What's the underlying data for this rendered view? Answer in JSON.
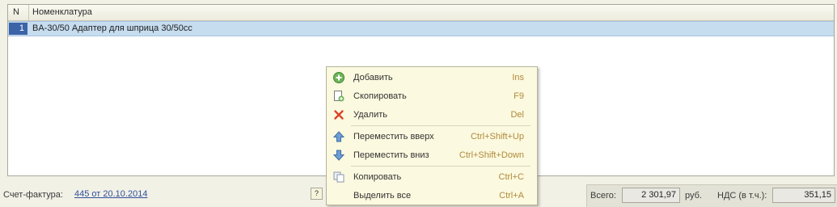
{
  "grid": {
    "headers": {
      "n": "N",
      "name": "Номенклатура"
    },
    "rows": [
      {
        "n": "1",
        "name": "BA-30/50 Адаптер для шприца 30/50cc"
      }
    ]
  },
  "context_menu": {
    "items": [
      {
        "label": "Добавить",
        "shortcut": "Ins",
        "icon": "add-icon"
      },
      {
        "label": "Скопировать",
        "shortcut": "F9",
        "icon": "copy-document-icon"
      },
      {
        "label": "Удалить",
        "shortcut": "Del",
        "icon": "delete-icon"
      },
      {
        "label": "Переместить вверх",
        "shortcut": "Ctrl+Shift+Up",
        "icon": "arrow-up-icon"
      },
      {
        "label": "Переместить вниз",
        "shortcut": "Ctrl+Shift+Down",
        "icon": "arrow-down-icon"
      },
      {
        "label": "Копировать",
        "shortcut": "Ctrl+C",
        "icon": "copy-icon"
      },
      {
        "label": "Выделить все",
        "shortcut": "Ctrl+A",
        "icon": ""
      }
    ]
  },
  "footer": {
    "invoice_label": "Счет-фактура:",
    "invoice_link": "445 от 20.10.2014",
    "help": "?"
  },
  "totals": {
    "total_label": "Всего:",
    "total_value": "2 301,97",
    "currency": "руб.",
    "vat_label": "НДС (в т.ч.):",
    "vat_value": "351,15"
  },
  "colors": {
    "selection": "#c6dcef",
    "row_number": "#3a63a8",
    "link": "#2f4f9a",
    "shortcut": "#b08a3c",
    "menu_bg": "#fbf9df"
  }
}
